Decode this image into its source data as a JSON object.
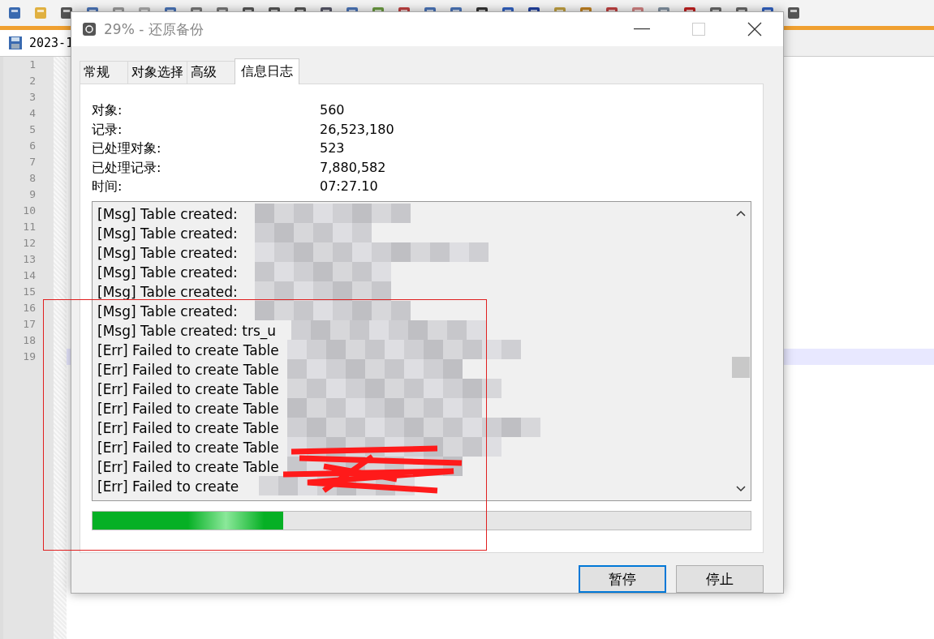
{
  "editor": {
    "tab": {
      "label": "2023-1"
    },
    "lines": [
      {
        "number": "1",
        "selected": false
      },
      {
        "number": "2",
        "selected": false
      },
      {
        "number": "3",
        "selected": false
      },
      {
        "number": "4",
        "selected": false
      },
      {
        "number": "5",
        "selected": false
      },
      {
        "number": "6",
        "selected": false
      },
      {
        "number": "7",
        "selected": false
      },
      {
        "number": "8",
        "selected": false
      },
      {
        "number": "9",
        "selected": false
      },
      {
        "number": "10",
        "selected": false
      },
      {
        "number": "11",
        "selected": false
      },
      {
        "number": "12",
        "selected": false
      },
      {
        "number": "13",
        "selected": false
      },
      {
        "number": "14",
        "selected": false
      },
      {
        "number": "15",
        "selected": false
      },
      {
        "number": "16",
        "selected": false
      },
      {
        "number": "17",
        "selected": false
      },
      {
        "number": "18",
        "selected": false
      },
      {
        "number": "19",
        "selected": true
      }
    ]
  },
  "dialog": {
    "title": "29% - 还原备份",
    "tabs": [
      {
        "label": "常规",
        "selected": false
      },
      {
        "label": "对象选择",
        "selected": false
      },
      {
        "label": "高级",
        "selected": false
      },
      {
        "label": "信息日志",
        "selected": true
      }
    ],
    "stats": [
      {
        "label": "对象:",
        "value": "560"
      },
      {
        "label": "记录:",
        "value": "26,523,180"
      },
      {
        "label": "已处理对象:",
        "value": "523"
      },
      {
        "label": "已处理记录:",
        "value": "7,880,582"
      },
      {
        "label": "时间:",
        "value": "07:27.10"
      }
    ],
    "log": [
      {
        "text": "[Msg] Table created:"
      },
      {
        "text": "[Msg] Table created:"
      },
      {
        "text": "[Msg] Table created:"
      },
      {
        "text": "[Msg] Table created:"
      },
      {
        "text": "[Msg] Table created:"
      },
      {
        "text": "[Msg] Table created:"
      },
      {
        "text": "[Msg] Table created: trs_u"
      },
      {
        "text": "[Err] Failed to create Table"
      },
      {
        "text": "[Err] Failed to create Table"
      },
      {
        "text": "[Err] Failed to create Table"
      },
      {
        "text": "[Err] Failed to create Table"
      },
      {
        "text": "[Err] Failed to create Table"
      },
      {
        "text": "[Err] Failed to create Table"
      },
      {
        "text": "[Err] Failed to create Table"
      },
      {
        "text": "[Err] Failed to create"
      }
    ],
    "progress": {
      "level": 0.29
    },
    "buttons": [
      {
        "label": "暂停",
        "selected": true
      },
      {
        "label": "停止",
        "selected": false
      }
    ]
  }
}
